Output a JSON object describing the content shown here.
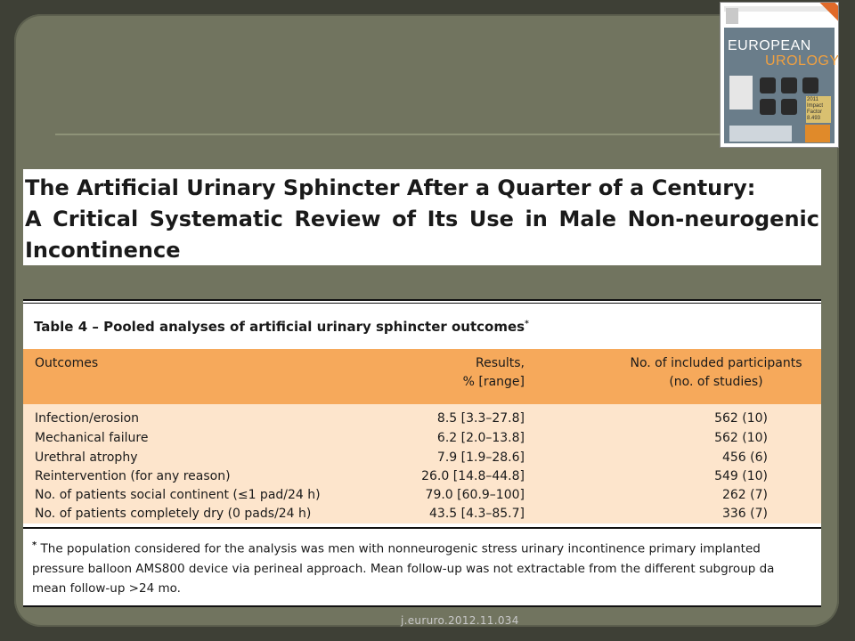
{
  "journal_cover": {
    "name_line1": "EUROPEAN",
    "name_line2": "UROLOGY",
    "impact_badge": "2011 Impact Factor 8.493"
  },
  "article_title": {
    "line1": "The Artificial Urinary Sphincter After a Quarter of a Century:",
    "line2": "A Critical Systematic Review of Its Use in Male Non-neurogenic",
    "line3": "Incontinence"
  },
  "table": {
    "caption": "Table 4 – Pooled analyses of artificial urinary sphincter outcomes",
    "caption_mark": "*",
    "headers": {
      "outcomes": "Outcomes",
      "results_l1": "Results,",
      "results_l2": "% [range]",
      "participants_l1": "No. of included participants",
      "participants_l2": "(no. of studies)"
    },
    "rows": [
      {
        "outcome": "Infection/erosion",
        "result": "8.5 [3.3–27.8]",
        "participants": "562 (10)"
      },
      {
        "outcome": "Mechanical failure",
        "result": "6.2 [2.0–13.8]",
        "participants": "562 (10)"
      },
      {
        "outcome": "Urethral atrophy",
        "result": "7.9 [1.9–28.6]",
        "participants": "456 (6)"
      },
      {
        "outcome": "Reintervention (for any reason)",
        "result": "26.0 [14.8–44.8]",
        "participants": "549 (10)"
      },
      {
        "outcome": "No. of patients social continent (≤1 pad/24 h)",
        "result": "79.0 [60.9–100]",
        "participants": "262 (7)"
      },
      {
        "outcome": "No. of patients completely dry (0 pads/24 h)",
        "result": "43.5 [4.3–85.7]",
        "participants": "336 (7)"
      }
    ],
    "footnote_mark": "*",
    "footnote_line1": "The population considered for the analysis was men with nonneurogenic stress urinary incontinence primary implanted",
    "footnote_line2": "pressure balloon AMS800 device via perineal approach. Mean follow-up was not extractable from the different subgroup da",
    "footnote_line3": "mean follow-up >24 mo."
  },
  "doi_reference": "j.eururo.2012.11.034",
  "colors": {
    "background": "#3e4036",
    "slide": "#71745f",
    "table_header": "#f6a95b",
    "table_body": "#fde5cc"
  }
}
